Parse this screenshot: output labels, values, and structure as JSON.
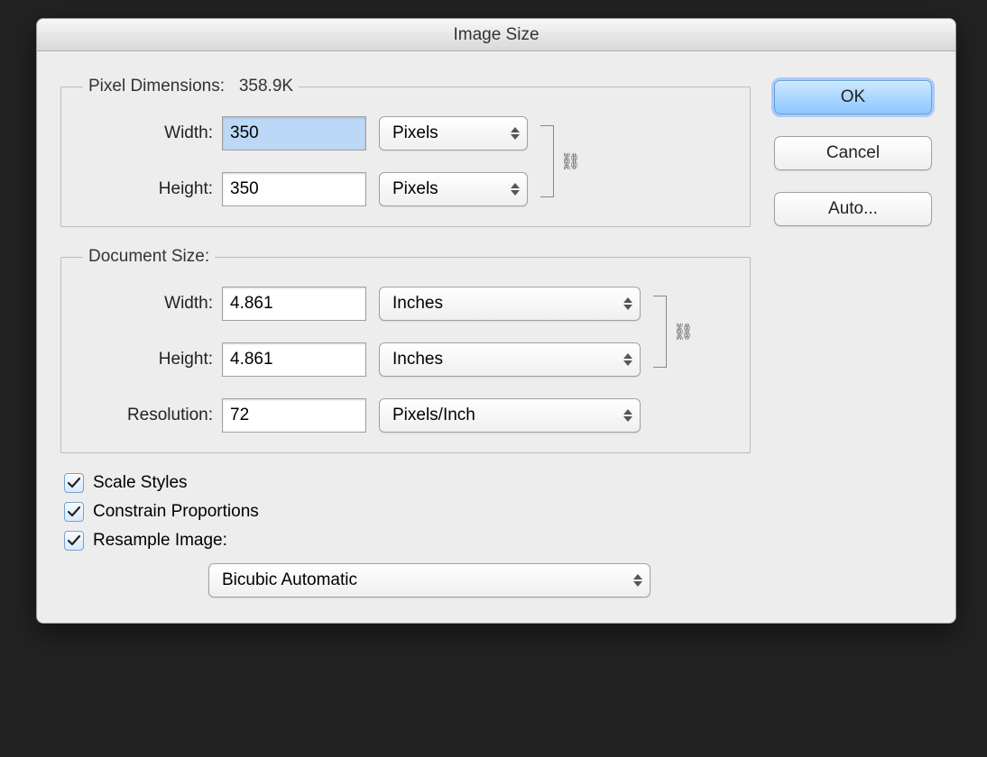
{
  "title": "Image Size",
  "buttons": {
    "ok": "OK",
    "cancel": "Cancel",
    "auto": "Auto..."
  },
  "pixel_dimensions": {
    "legend_prefix": "Pixel Dimensions:",
    "legend_size": "358.9K",
    "width_label": "Width:",
    "width_value": "350",
    "width_unit": "Pixels",
    "height_label": "Height:",
    "height_value": "350",
    "height_unit": "Pixels"
  },
  "document_size": {
    "legend": "Document Size:",
    "width_label": "Width:",
    "width_value": "4.861",
    "width_unit": "Inches",
    "height_label": "Height:",
    "height_value": "4.861",
    "height_unit": "Inches",
    "resolution_label": "Resolution:",
    "resolution_value": "72",
    "resolution_unit": "Pixels/Inch"
  },
  "checks": {
    "scale_styles": "Scale Styles",
    "constrain": "Constrain Proportions",
    "resample": "Resample Image:"
  },
  "resample_method": "Bicubic Automatic"
}
